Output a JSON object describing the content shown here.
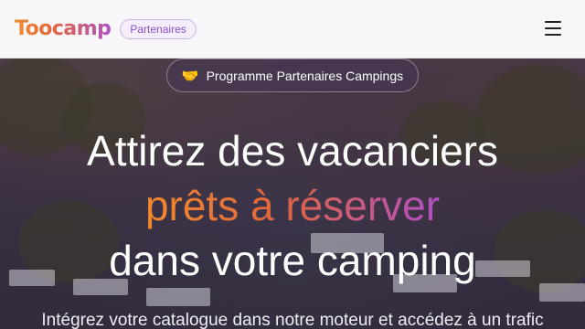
{
  "navbar": {
    "logo": "Toocamp",
    "badge": "Partenaires",
    "menu_icon": "hamburger-menu-icon"
  },
  "hero": {
    "program_pill": {
      "emoji": "🤝",
      "label": "Programme Partenaires Campings"
    },
    "headline_line1": "Attirez des vacanciers",
    "headline_line2": "prêts à réserver",
    "headline_line3": "dans votre camping",
    "subtext": "Intégrez votre catalogue dans notre moteur et accédez à un trafic"
  },
  "colors": {
    "gradient_start": "#f08a2c",
    "gradient_end": "#b14fc4",
    "navbar_bg": "#f7f7f9"
  }
}
